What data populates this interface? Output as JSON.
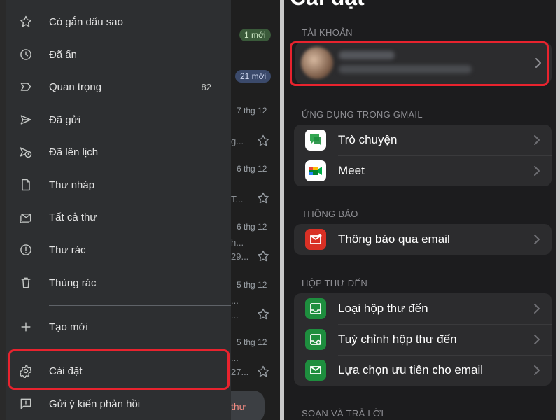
{
  "drawer": {
    "items": [
      {
        "label": "Có gắn dấu sao",
        "icon": "star-icon"
      },
      {
        "label": "Đã ẩn",
        "icon": "clock-icon"
      },
      {
        "label": "Quan trọng",
        "icon": "important-label-icon",
        "count": "82"
      },
      {
        "label": "Đã gửi",
        "icon": "send-icon"
      },
      {
        "label": "Đã lên lịch",
        "icon": "scheduled-send-icon"
      },
      {
        "label": "Thư nháp",
        "icon": "file-icon"
      },
      {
        "label": "Tất cả thư",
        "icon": "all-mail-icon"
      },
      {
        "label": "Thư rác",
        "icon": "alert-circle-icon"
      },
      {
        "label": "Thùng rác",
        "icon": "trash-icon"
      }
    ],
    "create_label": "Tạo mới",
    "settings_label": "Cài đặt",
    "feedback_label": "Gửi ý kiến phản hồi"
  },
  "inbox_behind": {
    "badge_green": "1 mới",
    "badge_blue": "21 mới",
    "dates": [
      "7 thg 12",
      "6 thg 12",
      "6 thg 12",
      "5 thg 12",
      "5 thg 12"
    ],
    "snippets": [
      "g...",
      "T...",
      "h...",
      "29...",
      "...",
      "...",
      "27...",
      "..."
    ],
    "compose_label": "thư"
  },
  "settings": {
    "title": "Cài đặt",
    "sections": {
      "account": "TÀI KHOẢN",
      "apps": "ỨNG DỤNG TRONG GMAIL",
      "notifications": "THÔNG BÁO",
      "inbox": "HỘP THƯ ĐẾN",
      "compose": "SOẠN VÀ TRẢ LỜI"
    },
    "apps_rows": [
      {
        "label": "Trò chuyện",
        "icon": "google-chat-icon"
      },
      {
        "label": "Meet",
        "icon": "google-meet-icon"
      }
    ],
    "notification_rows": [
      {
        "label": "Thông báo qua email",
        "icon": "email-notification-icon"
      }
    ],
    "inbox_rows": [
      {
        "label": "Loại hộp thư đến",
        "icon": "inbox-type-icon"
      },
      {
        "label": "Tuỳ chỉnh hộp thư đến",
        "icon": "inbox-customize-icon"
      },
      {
        "label": "Lựa chọn ưu tiên cho email",
        "icon": "email-preference-icon"
      }
    ]
  },
  "colors": {
    "highlight": "#e8232e",
    "chat_green": "#34a853",
    "notify_red": "#d93025",
    "inbox_green": "#1e8e3e"
  }
}
